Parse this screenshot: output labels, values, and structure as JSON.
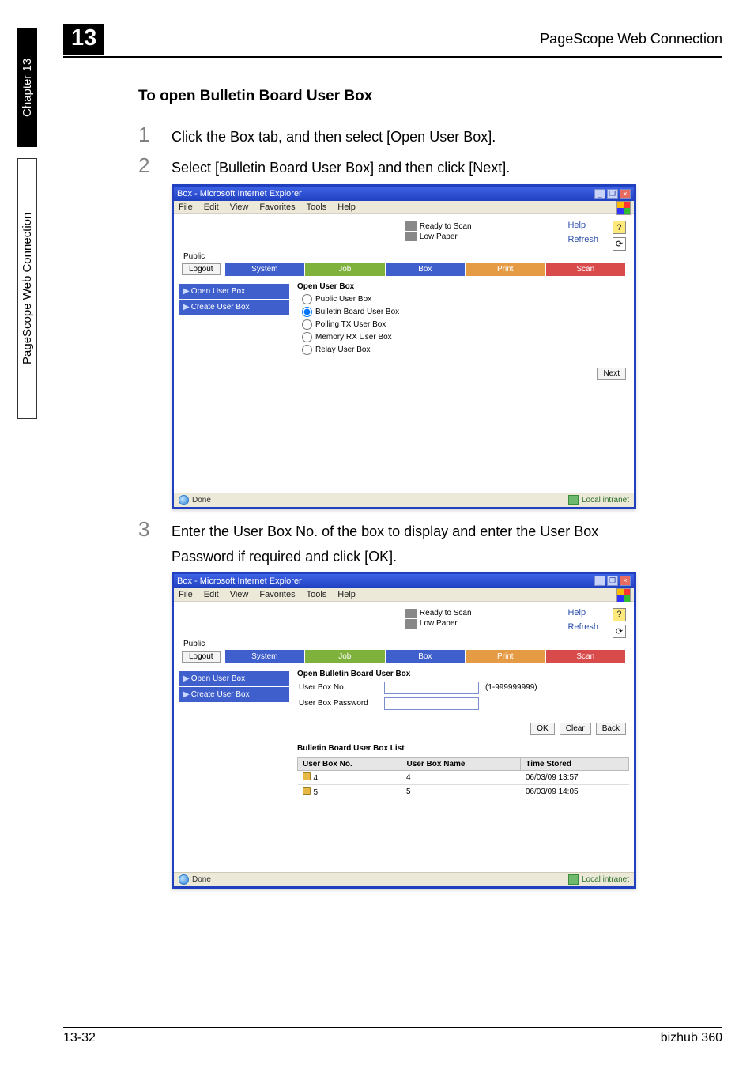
{
  "side": {
    "chapter_tab": "Chapter 13",
    "conn_tab": "PageScope Web Connection"
  },
  "header": {
    "chapnum": "13",
    "title": "PageScope Web Connection"
  },
  "section_title": "To open Bulletin Board User Box",
  "steps": {
    "s1": "Click the Box tab, and then select [Open User Box].",
    "s2": "Select [Bulletin Board User Box] and then click [Next].",
    "s3a": "Enter the User Box No. of the box to display and enter the User Box",
    "s3b": "Password if required and click [OK]."
  },
  "ie": {
    "title": "Box - Microsoft Internet Explorer",
    "menus": {
      "file": "File",
      "edit": "Edit",
      "view": "View",
      "fav": "Favorites",
      "tools": "Tools",
      "help": "Help"
    },
    "status_ready": "Ready to Scan",
    "status_paper": "Low Paper",
    "help": "Help",
    "refresh": "Refresh",
    "public": "Public",
    "logout": "Logout",
    "tabs": {
      "system": "System",
      "job": "Job",
      "box": "Box",
      "print": "Print",
      "scan": "Scan"
    },
    "nav": {
      "open": "Open User Box",
      "create": "Create User Box"
    },
    "pane1": {
      "title": "Open User Box",
      "r1": "Public User Box",
      "r2": "Bulletin Board User Box",
      "r3": "Polling TX User Box",
      "r4": "Memory RX User Box",
      "r5": "Relay User Box",
      "next": "Next"
    },
    "pane2": {
      "title": "Open Bulletin Board User Box",
      "ubno_lbl": "User Box No.",
      "ubno_hint": "(1-999999999)",
      "pw_lbl": "User Box Password",
      "ok": "OK",
      "clear": "Clear",
      "back": "Back",
      "list_title": "Bulletin Board User Box List",
      "cols": {
        "no": "User Box No.",
        "name": "User Box Name",
        "time": "Time Stored"
      },
      "rows": [
        {
          "no": "4",
          "name": "4",
          "time": "06/03/09 13:57"
        },
        {
          "no": "5",
          "name": "5",
          "time": "06/03/09 14:05"
        }
      ]
    },
    "done": "Done",
    "zone": "Local intranet"
  },
  "footer": {
    "left": "13-32",
    "right": "bizhub 360"
  }
}
